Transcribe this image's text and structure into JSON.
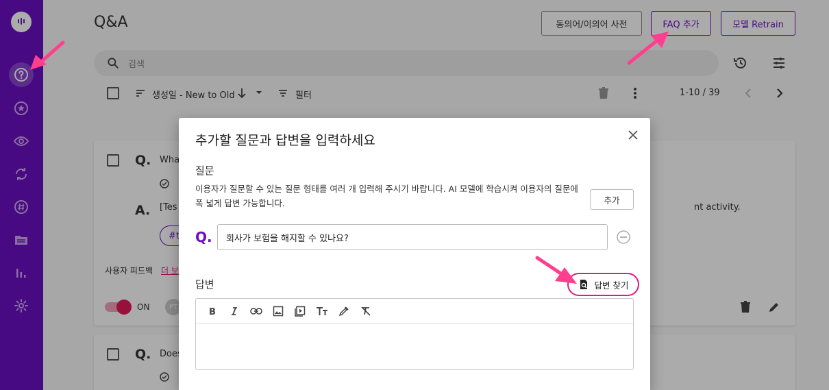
{
  "page": {
    "title": "Q&A",
    "buttons": {
      "synonym_dict": "동의어/이의어 사전",
      "add_faq": "FAQ 추가",
      "model_retrain": "모델 Retrain"
    },
    "search_placeholder": "검색",
    "toolbar": {
      "sort_label": "생성일 - New to Old",
      "filter_label": "필터",
      "pagination": "1-10 / 39"
    },
    "cards": [
      {
        "q_letter": "Q.",
        "q_text": "Wha",
        "a_letter": "A.",
        "a_text": "[Tes",
        "a_tail": "nt activity.",
        "tag": "#te",
        "feedback_label": "사용자 피드백",
        "feedback_link": "더 보",
        "toggle_label": "ON",
        "avatar": "PT"
      },
      {
        "q_letter": "Q.",
        "q_text": "Does"
      }
    ]
  },
  "dialog": {
    "title": "추가할 질문과 답변을 입력하세요",
    "question_label": "질문",
    "description": "이용자가 질문할 수 있는 질문 형태를 여러 개 입력해 주시기 바랍니다. AI 모델에 학습시켜 이용자의 질문에 폭 넓게 답변 가능합니다.",
    "add_button": "추가",
    "q_prefix": "Q.",
    "question_value": "회사가 보험을 해지할 수 있나요?",
    "answer_label": "답변",
    "find_answer_button": "답변 찾기",
    "editor_tools": [
      "bold-icon",
      "italic-icon",
      "link-icon",
      "image-icon",
      "video-icon",
      "text-size-icon",
      "color-picker-icon",
      "clear-format-icon"
    ]
  },
  "colors": {
    "sidebar": "#6a0fc4",
    "accent": "#6a0fc4",
    "highlight": "#e6197a",
    "arrow": "#ff3f8e"
  }
}
